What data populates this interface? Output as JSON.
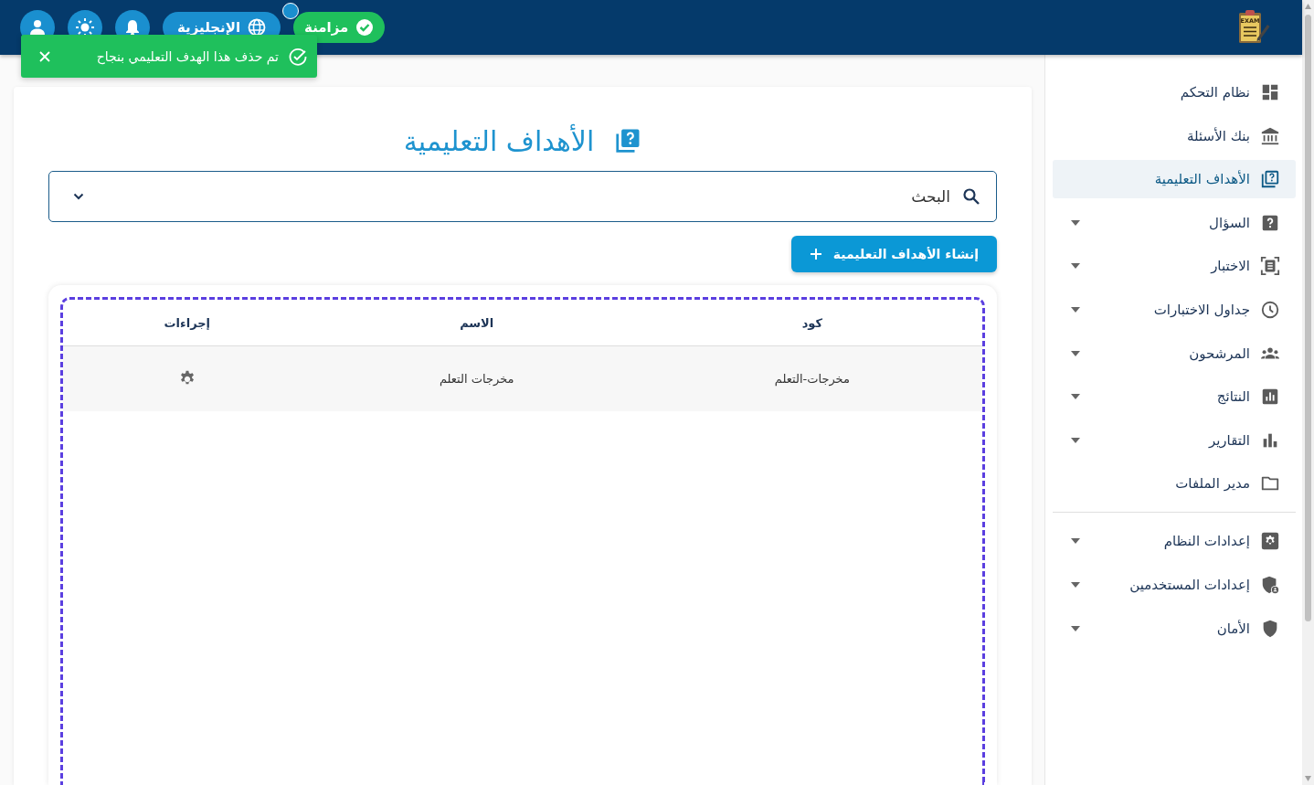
{
  "header": {
    "logo_text": "EXAM",
    "sync_button": {
      "label": "مزامنة"
    },
    "language_button": {
      "label": "الإنجليزية"
    }
  },
  "toast": {
    "message": "تم حذف هذا الهدف التعليمي بنجاح"
  },
  "sidebar": {
    "main_items": [
      {
        "label": "نظام التحكم",
        "selected": false,
        "expandable": false
      },
      {
        "label": "بنك الأسئلة",
        "selected": false,
        "expandable": false
      },
      {
        "label": "الأهداف التعليمية",
        "selected": true,
        "expandable": false
      },
      {
        "label": "السؤال",
        "selected": false,
        "expandable": true
      },
      {
        "label": "الاختبار",
        "selected": false,
        "expandable": true
      },
      {
        "label": "جداول الاختبارات",
        "selected": false,
        "expandable": true
      },
      {
        "label": "المرشحون",
        "selected": false,
        "expandable": true
      },
      {
        "label": "النتائج",
        "selected": false,
        "expandable": true
      },
      {
        "label": "التقارير",
        "selected": false,
        "expandable": true
      },
      {
        "label": "مدير الملفات",
        "selected": false,
        "expandable": false
      }
    ],
    "settings_items": [
      {
        "label": "إعدادات النظام",
        "selected": false,
        "expandable": true
      },
      {
        "label": "إعدادات المستخدمين",
        "selected": false,
        "expandable": true
      },
      {
        "label": "الأمان",
        "selected": false,
        "expandable": true
      }
    ]
  },
  "page": {
    "title": "الأهداف التعليمية",
    "search": {
      "placeholder": "البحث"
    },
    "create_button": "إنشاء الأهداف التعليمية",
    "table": {
      "columns": [
        "كود",
        "الاسم",
        "إجراءات"
      ],
      "rows": [
        {
          "code": "مخرجات-التعلم",
          "name": "مخرجات التعلم"
        }
      ]
    }
  }
}
